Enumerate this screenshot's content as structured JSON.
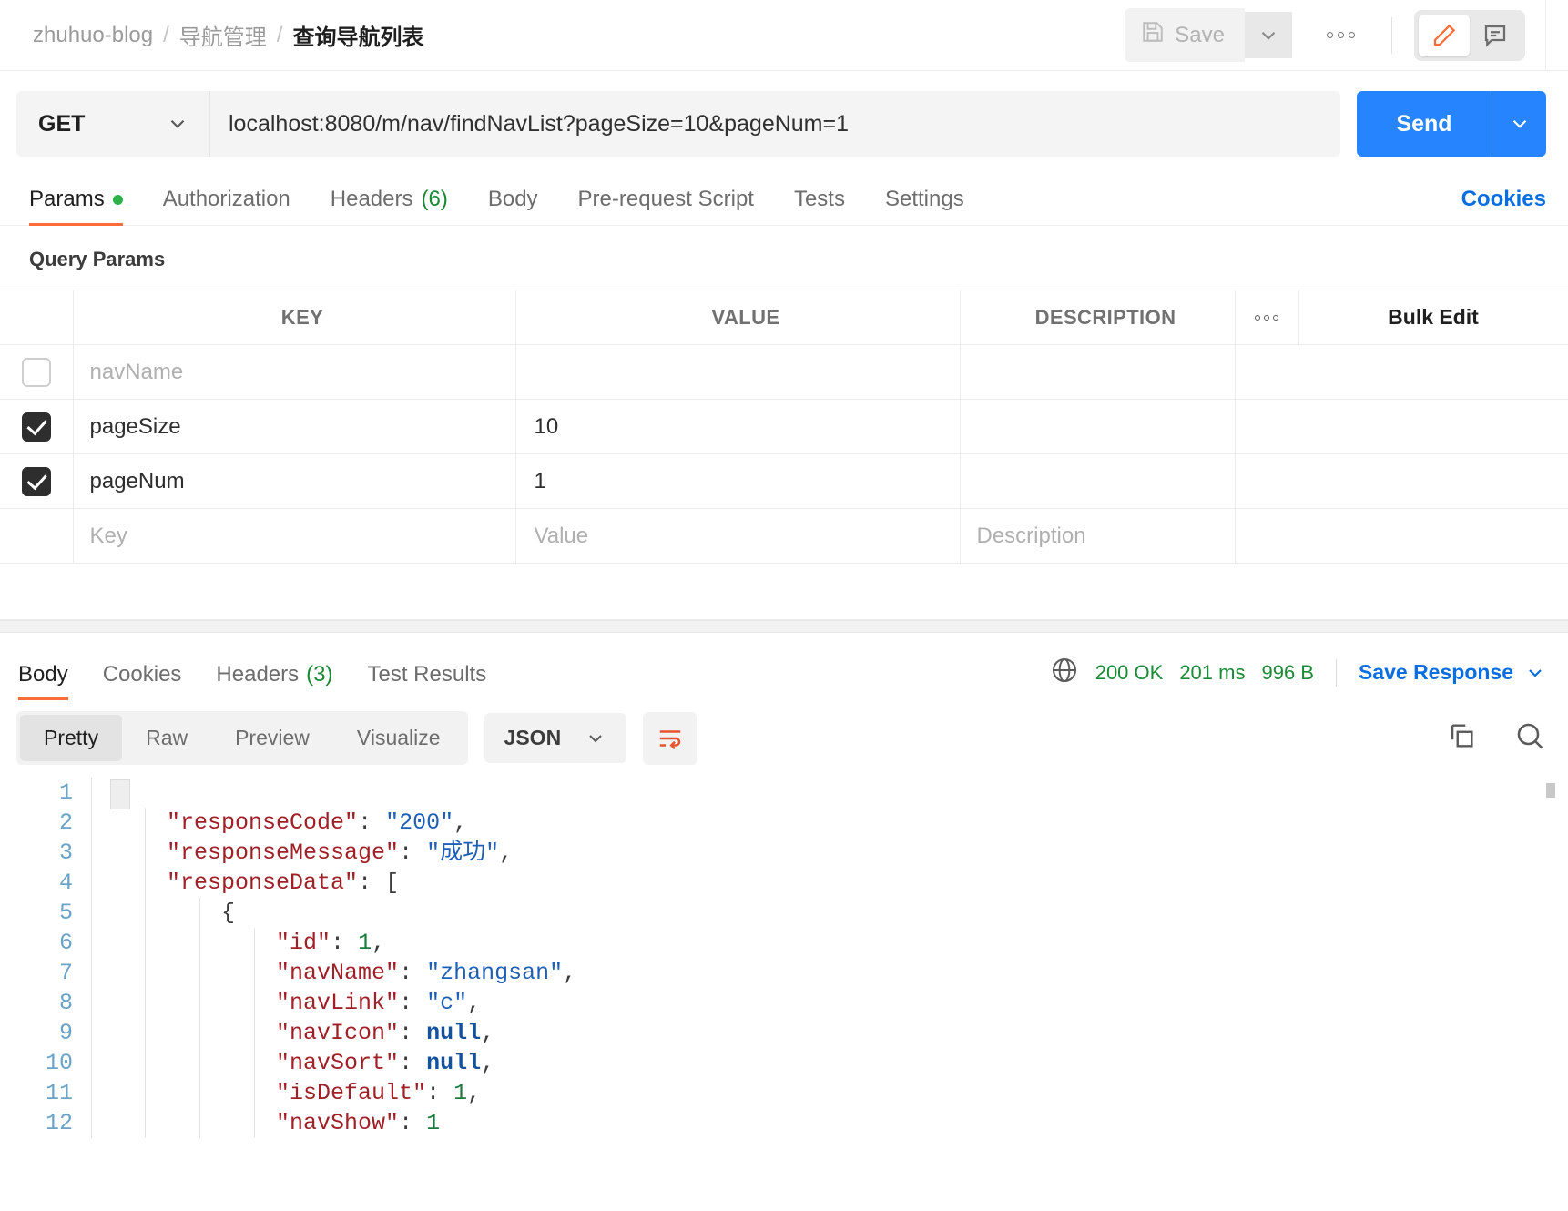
{
  "header": {
    "breadcrumb": [
      "zhuhuo-blog",
      "导航管理",
      "查询导航列表"
    ],
    "separator": "/",
    "save_label": "Save",
    "save_icon": "floppy-disk-icon",
    "caret_icon": "chevron-down-icon",
    "more_icon": "more-options-icon",
    "edit_icon": "pencil-icon",
    "comment_icon": "comment-icon"
  },
  "request": {
    "method": "GET",
    "url": "localhost:8080/m/nav/findNavList?pageSize=10&pageNum=1",
    "send_label": "Send"
  },
  "req_tabs": [
    {
      "label": "Params",
      "active": true,
      "dot": true
    },
    {
      "label": "Authorization",
      "active": false
    },
    {
      "label": "Headers",
      "count": "(6)",
      "active": false
    },
    {
      "label": "Body",
      "active": false
    },
    {
      "label": "Pre-request Script",
      "active": false
    },
    {
      "label": "Tests",
      "active": false
    },
    {
      "label": "Settings",
      "active": false
    }
  ],
  "cookies_link": "Cookies",
  "query_params": {
    "title": "Query Params",
    "headers": {
      "key": "KEY",
      "value": "VALUE",
      "description": "DESCRIPTION",
      "bulk_edit": "Bulk Edit"
    },
    "rows": [
      {
        "checked": false,
        "key": "navName",
        "key_placeholder": true,
        "value": "",
        "description": ""
      },
      {
        "checked": true,
        "key": "pageSize",
        "key_placeholder": false,
        "value": "10",
        "description": ""
      },
      {
        "checked": true,
        "key": "pageNum",
        "key_placeholder": false,
        "value": "1",
        "description": ""
      }
    ],
    "new_row": {
      "key": "Key",
      "value": "Value",
      "description": "Description"
    }
  },
  "response": {
    "tabs": [
      {
        "label": "Body",
        "active": true
      },
      {
        "label": "Cookies",
        "active": false
      },
      {
        "label": "Headers",
        "count": "(3)",
        "active": false
      },
      {
        "label": "Test Results",
        "active": false
      }
    ],
    "status": "200 OK",
    "time": "201 ms",
    "size": "996 B",
    "globe_icon": "globe-icon",
    "save_response": "Save Response",
    "view_modes": [
      "Pretty",
      "Raw",
      "Preview",
      "Visualize"
    ],
    "active_view": "Pretty",
    "format": "JSON",
    "wrap_icon": "word-wrap-icon",
    "copy_icon": "copy-icon",
    "search_icon": "search-icon",
    "body_lines": [
      {
        "n": "1",
        "tokens": [
          {
            "t": "{",
            "c": "p"
          }
        ],
        "indent": 0
      },
      {
        "n": "2",
        "tokens": [
          {
            "t": "\"responseCode\"",
            "c": "k"
          },
          {
            "t": ": ",
            "c": "p"
          },
          {
            "t": "\"200\"",
            "c": "s"
          },
          {
            "t": ",",
            "c": "p"
          }
        ],
        "indent": 1
      },
      {
        "n": "3",
        "tokens": [
          {
            "t": "\"responseMessage\"",
            "c": "k"
          },
          {
            "t": ": ",
            "c": "p"
          },
          {
            "t": "\"成功\"",
            "c": "s"
          },
          {
            "t": ",",
            "c": "p"
          }
        ],
        "indent": 1
      },
      {
        "n": "4",
        "tokens": [
          {
            "t": "\"responseData\"",
            "c": "k"
          },
          {
            "t": ": ",
            "c": "p"
          },
          {
            "t": "[",
            "c": "p"
          }
        ],
        "indent": 1
      },
      {
        "n": "5",
        "tokens": [
          {
            "t": "{",
            "c": "p"
          }
        ],
        "indent": 2
      },
      {
        "n": "6",
        "tokens": [
          {
            "t": "\"id\"",
            "c": "k"
          },
          {
            "t": ": ",
            "c": "p"
          },
          {
            "t": "1",
            "c": "n"
          },
          {
            "t": ",",
            "c": "p"
          }
        ],
        "indent": 3
      },
      {
        "n": "7",
        "tokens": [
          {
            "t": "\"navName\"",
            "c": "k"
          },
          {
            "t": ": ",
            "c": "p"
          },
          {
            "t": "\"zhangsan\"",
            "c": "s"
          },
          {
            "t": ",",
            "c": "p"
          }
        ],
        "indent": 3
      },
      {
        "n": "8",
        "tokens": [
          {
            "t": "\"navLink\"",
            "c": "k"
          },
          {
            "t": ": ",
            "c": "p"
          },
          {
            "t": "\"c\"",
            "c": "s"
          },
          {
            "t": ",",
            "c": "p"
          }
        ],
        "indent": 3
      },
      {
        "n": "9",
        "tokens": [
          {
            "t": "\"navIcon\"",
            "c": "k"
          },
          {
            "t": ": ",
            "c": "p"
          },
          {
            "t": "null",
            "c": "nu"
          },
          {
            "t": ",",
            "c": "p"
          }
        ],
        "indent": 3
      },
      {
        "n": "10",
        "tokens": [
          {
            "t": "\"navSort\"",
            "c": "k"
          },
          {
            "t": ": ",
            "c": "p"
          },
          {
            "t": "null",
            "c": "nu"
          },
          {
            "t": ",",
            "c": "p"
          }
        ],
        "indent": 3
      },
      {
        "n": "11",
        "tokens": [
          {
            "t": "\"isDefault\"",
            "c": "k"
          },
          {
            "t": ": ",
            "c": "p"
          },
          {
            "t": "1",
            "c": "n"
          },
          {
            "t": ",",
            "c": "p"
          }
        ],
        "indent": 3
      },
      {
        "n": "12",
        "tokens": [
          {
            "t": "\"navShow\"",
            "c": "k"
          },
          {
            "t": ": ",
            "c": "p"
          },
          {
            "t": "1",
            "c": "n"
          }
        ],
        "indent": 3
      }
    ]
  },
  "colors": {
    "accent": "#ff6c37",
    "link": "#0b6ee0",
    "send": "#2684ff",
    "success": "#1a8a36"
  }
}
